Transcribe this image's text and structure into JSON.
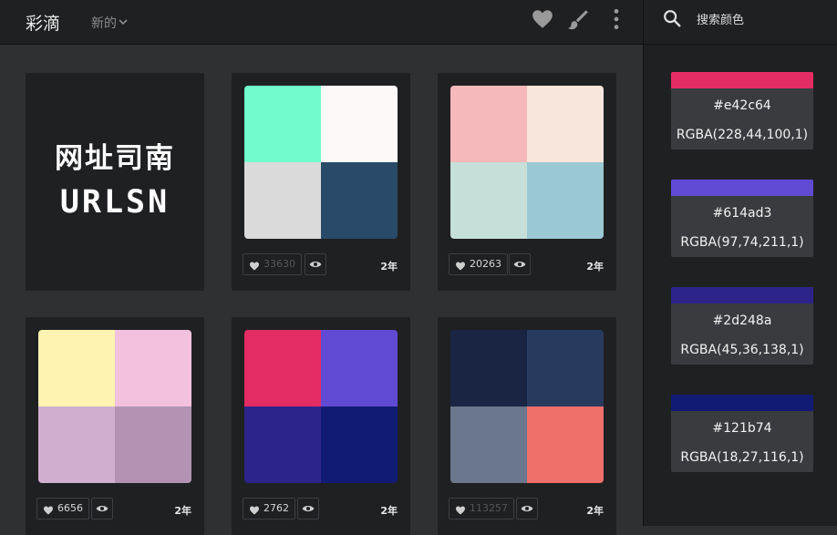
{
  "header": {
    "logo": "彩滴",
    "nav_new": "新的",
    "icons": [
      "heart-icon",
      "brush-icon",
      "more-vertical-icon"
    ]
  },
  "search": {
    "placeholder": "搜索颜色"
  },
  "side_colors": [
    {
      "hex": "#e42c64",
      "rgba": "RGBA(228,44,100,1)"
    },
    {
      "hex": "#614ad3",
      "rgba": "RGBA(97,74,211,1)"
    },
    {
      "hex": "#2d248a",
      "rgba": "RGBA(45,36,138,1)"
    },
    {
      "hex": "#121b74",
      "rgba": "RGBA(18,27,116,1)"
    }
  ],
  "ad": {
    "line1": "网址司南",
    "line2": "URLSN"
  },
  "cards": [
    {
      "colors": [
        "#71fbcc",
        "#fdf9f9",
        "#dadada",
        "#294a68"
      ],
      "likes": "33630",
      "age": "2年"
    },
    {
      "colors": [
        "#f5b8bb",
        "#f8e5db",
        "#c6dfd9",
        "#9ac8d3"
      ],
      "likes": "20263",
      "age": "2年"
    },
    {
      "colors": [
        "#fff3b1",
        "#f2c1de",
        "#cfafcf",
        "#b293b3"
      ],
      "likes": "6656",
      "age": "2年"
    },
    {
      "colors": [
        "#e42c64",
        "#614ad3",
        "#2d248a",
        "#121b74"
      ],
      "likes": "2762",
      "age": "2年"
    },
    {
      "colors": [
        "#1a2544",
        "#283a5e",
        "#6b778c",
        "#ef706b"
      ],
      "likes": "113257",
      "age": "2年"
    }
  ]
}
